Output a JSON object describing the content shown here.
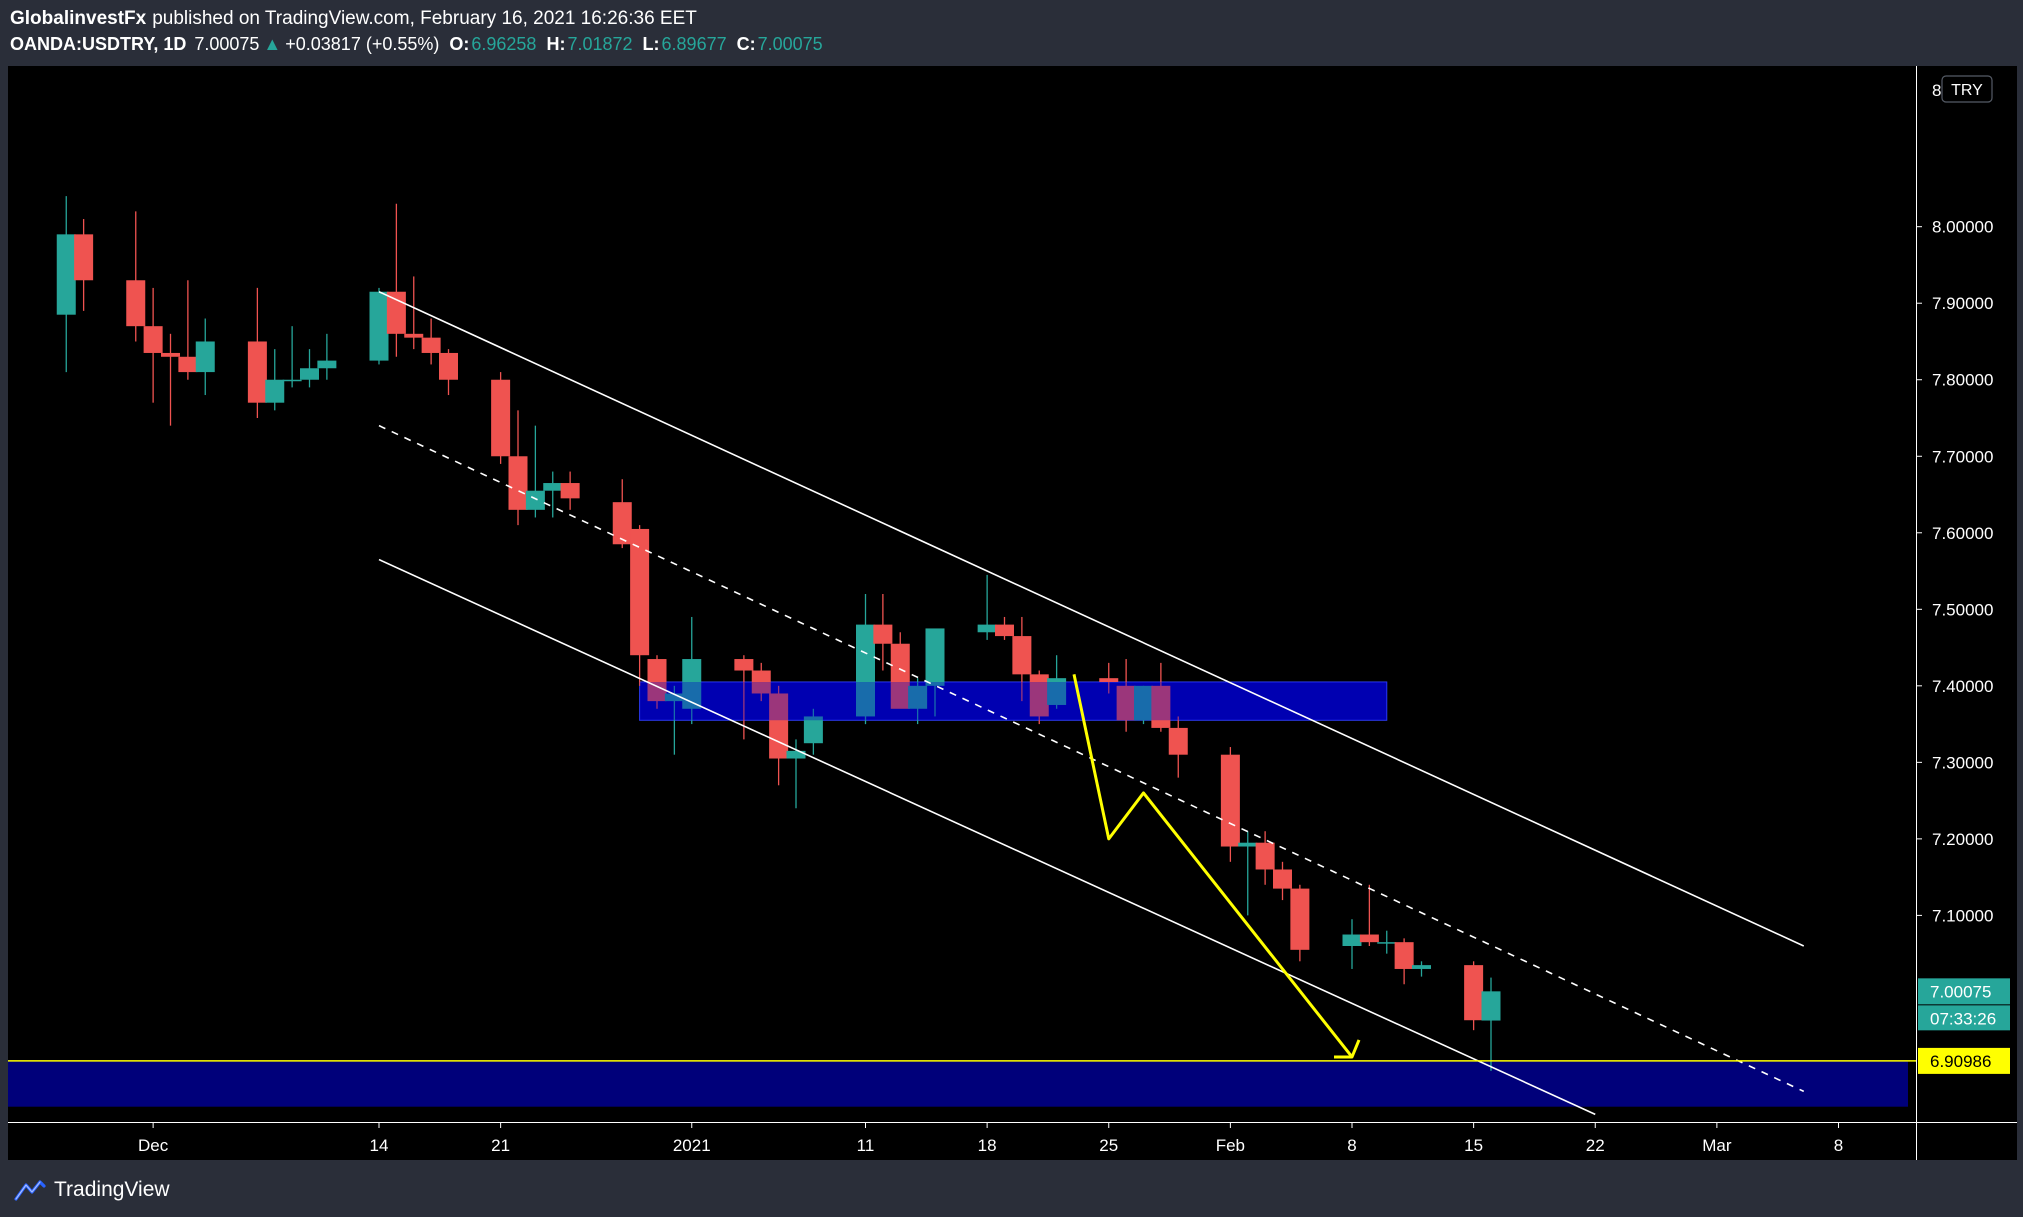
{
  "header": {
    "author": "GlobalinvestFx",
    "published": "published on TradingView.com, February 16, 2021 16:26:36 EET",
    "symbol": "OANDA:USDTRY, 1D",
    "last": "7.00075",
    "change": "+0.03817 (+0.55%)",
    "o_label": "O:",
    "o_value": "6.96258",
    "h_label": "H:",
    "h_value": "7.01872",
    "l_label": "L:",
    "l_value": "6.89677",
    "c_label": "C:",
    "c_value": "7.00075"
  },
  "footer": {
    "brand": "TradingView",
    "logo_icon": "tradingview-logo-icon"
  },
  "colors": {
    "up": "#26a69a",
    "down": "#ef5350",
    "zone": "#0000cc",
    "support": "#ffff00",
    "channel": "#ffffff",
    "path": "#ffff00",
    "background": "#000000",
    "axis_text": "#ffffff"
  },
  "chart_data": {
    "type": "candlestick",
    "currency": "TRY",
    "ylim": [
      6.83,
      8.21
    ],
    "y_ticks": [
      "8.00000",
      "7.90000",
      "7.80000",
      "7.70000",
      "7.60000",
      "7.50000",
      "7.40000",
      "7.30000",
      "7.20000",
      "7.10000"
    ],
    "x_ticks": [
      {
        "label": "Dec",
        "date": "2020-12-01"
      },
      {
        "label": "14",
        "date": "2020-12-14"
      },
      {
        "label": "21",
        "date": "2020-12-21"
      },
      {
        "label": "2021",
        "date": "2021-01-01"
      },
      {
        "label": "11",
        "date": "2021-01-11"
      },
      {
        "label": "18",
        "date": "2021-01-18"
      },
      {
        "label": "25",
        "date": "2021-01-25"
      },
      {
        "label": "Feb",
        "date": "2021-02-01"
      },
      {
        "label": "8",
        "date": "2021-02-08"
      },
      {
        "label": "15",
        "date": "2021-02-15"
      },
      {
        "label": "22",
        "date": "2021-02-22"
      },
      {
        "label": "Mar",
        "date": "2021-03-01"
      },
      {
        "label": "8",
        "date": "2021-03-08"
      }
    ],
    "price_labels": {
      "last_price": "7.00075",
      "countdown": "07:33:26",
      "support_price": "6.90986"
    },
    "candles": [
      {
        "date": "2020-11-26",
        "o": 7.885,
        "h": 8.04,
        "l": 7.81,
        "c": 7.99
      },
      {
        "date": "2020-11-27",
        "o": 7.99,
        "h": 8.01,
        "l": 7.89,
        "c": 7.93
      },
      {
        "date": "2020-11-30",
        "o": 7.93,
        "h": 8.02,
        "l": 7.85,
        "c": 7.87
      },
      {
        "date": "2020-12-01",
        "o": 7.87,
        "h": 7.92,
        "l": 7.77,
        "c": 7.835
      },
      {
        "date": "2020-12-02",
        "o": 7.835,
        "h": 7.86,
        "l": 7.74,
        "c": 7.83
      },
      {
        "date": "2020-12-03",
        "o": 7.83,
        "h": 7.93,
        "l": 7.8,
        "c": 7.81
      },
      {
        "date": "2020-12-04",
        "o": 7.81,
        "h": 7.88,
        "l": 7.78,
        "c": 7.85
      },
      {
        "date": "2020-12-07",
        "o": 7.85,
        "h": 7.92,
        "l": 7.75,
        "c": 7.77
      },
      {
        "date": "2020-12-08",
        "o": 7.77,
        "h": 7.84,
        "l": 7.76,
        "c": 7.8
      },
      {
        "date": "2020-12-09",
        "o": 7.8,
        "h": 7.87,
        "l": 7.79,
        "c": 7.8
      },
      {
        "date": "2020-12-10",
        "o": 7.8,
        "h": 7.84,
        "l": 7.79,
        "c": 7.815
      },
      {
        "date": "2020-12-11",
        "o": 7.815,
        "h": 7.86,
        "l": 7.8,
        "c": 7.825
      },
      {
        "date": "2020-12-14",
        "o": 7.825,
        "h": 7.92,
        "l": 7.82,
        "c": 7.915
      },
      {
        "date": "2020-12-15",
        "o": 7.915,
        "h": 8.03,
        "l": 7.83,
        "c": 7.86
      },
      {
        "date": "2020-12-16",
        "o": 7.86,
        "h": 7.935,
        "l": 7.84,
        "c": 7.855
      },
      {
        "date": "2020-12-17",
        "o": 7.855,
        "h": 7.88,
        "l": 7.82,
        "c": 7.835
      },
      {
        "date": "2020-12-18",
        "o": 7.835,
        "h": 7.84,
        "l": 7.78,
        "c": 7.8
      },
      {
        "date": "2020-12-21",
        "o": 7.8,
        "h": 7.81,
        "l": 7.69,
        "c": 7.7
      },
      {
        "date": "2020-12-22",
        "o": 7.7,
        "h": 7.76,
        "l": 7.61,
        "c": 7.63
      },
      {
        "date": "2020-12-23",
        "o": 7.63,
        "h": 7.74,
        "l": 7.62,
        "c": 7.655
      },
      {
        "date": "2020-12-24",
        "o": 7.655,
        "h": 7.68,
        "l": 7.62,
        "c": 7.665
      },
      {
        "date": "2020-12-25",
        "o": 7.665,
        "h": 7.68,
        "l": 7.63,
        "c": 7.645
      },
      {
        "date": "2020-12-28",
        "o": 7.64,
        "h": 7.67,
        "l": 7.58,
        "c": 7.585
      },
      {
        "date": "2020-12-29",
        "o": 7.605,
        "h": 7.61,
        "l": 7.4,
        "c": 7.44
      },
      {
        "date": "2020-12-30",
        "o": 7.435,
        "h": 7.44,
        "l": 7.37,
        "c": 7.38
      },
      {
        "date": "2020-12-31",
        "o": 7.38,
        "h": 7.4,
        "l": 7.31,
        "c": 7.39
      },
      {
        "date": "2021-01-01",
        "o": 7.37,
        "h": 7.49,
        "l": 7.35,
        "c": 7.435
      },
      {
        "date": "2021-01-04",
        "o": 7.435,
        "h": 7.44,
        "l": 7.33,
        "c": 7.42
      },
      {
        "date": "2021-01-05",
        "o": 7.42,
        "h": 7.43,
        "l": 7.38,
        "c": 7.39
      },
      {
        "date": "2021-01-06",
        "o": 7.39,
        "h": 7.4,
        "l": 7.27,
        "c": 7.305
      },
      {
        "date": "2021-01-07",
        "o": 7.305,
        "h": 7.33,
        "l": 7.24,
        "c": 7.315
      },
      {
        "date": "2021-01-08",
        "o": 7.325,
        "h": 7.37,
        "l": 7.31,
        "c": 7.36
      },
      {
        "date": "2021-01-11",
        "o": 7.36,
        "h": 7.52,
        "l": 7.35,
        "c": 7.48
      },
      {
        "date": "2021-01-12",
        "o": 7.48,
        "h": 7.52,
        "l": 7.42,
        "c": 7.455
      },
      {
        "date": "2021-01-13",
        "o": 7.455,
        "h": 7.47,
        "l": 7.38,
        "c": 7.37
      },
      {
        "date": "2021-01-14",
        "o": 7.37,
        "h": 7.41,
        "l": 7.35,
        "c": 7.4
      },
      {
        "date": "2021-01-15",
        "o": 7.4,
        "h": 7.47,
        "l": 7.36,
        "c": 7.475
      },
      {
        "date": "2021-01-18",
        "o": 7.47,
        "h": 7.545,
        "l": 7.46,
        "c": 7.48
      },
      {
        "date": "2021-01-19",
        "o": 7.48,
        "h": 7.49,
        "l": 7.46,
        "c": 7.465
      },
      {
        "date": "2021-01-20",
        "o": 7.465,
        "h": 7.49,
        "l": 7.38,
        "c": 7.415
      },
      {
        "date": "2021-01-21",
        "o": 7.415,
        "h": 7.42,
        "l": 7.35,
        "c": 7.36
      },
      {
        "date": "2021-01-22",
        "o": 7.375,
        "h": 7.44,
        "l": 7.37,
        "c": 7.41
      },
      {
        "date": "2021-01-25",
        "o": 7.41,
        "h": 7.43,
        "l": 7.39,
        "c": 7.405
      },
      {
        "date": "2021-01-26",
        "o": 7.4,
        "h": 7.435,
        "l": 7.34,
        "c": 7.355
      },
      {
        "date": "2021-01-27",
        "o": 7.355,
        "h": 7.4,
        "l": 7.35,
        "c": 7.4
      },
      {
        "date": "2021-01-28",
        "o": 7.4,
        "h": 7.43,
        "l": 7.34,
        "c": 7.345
      },
      {
        "date": "2021-01-29",
        "o": 7.345,
        "h": 7.36,
        "l": 7.28,
        "c": 7.31
      },
      {
        "date": "2021-02-01",
        "o": 7.31,
        "h": 7.32,
        "l": 7.17,
        "c": 7.19
      },
      {
        "date": "2021-02-02",
        "o": 7.19,
        "h": 7.21,
        "l": 7.1,
        "c": 7.195
      },
      {
        "date": "2021-02-03",
        "o": 7.195,
        "h": 7.21,
        "l": 7.14,
        "c": 7.16
      },
      {
        "date": "2021-02-04",
        "o": 7.16,
        "h": 7.17,
        "l": 7.12,
        "c": 7.135
      },
      {
        "date": "2021-02-05",
        "o": 7.135,
        "h": 7.14,
        "l": 7.04,
        "c": 7.055
      },
      {
        "date": "2021-02-08",
        "o": 7.06,
        "h": 7.095,
        "l": 7.03,
        "c": 7.075
      },
      {
        "date": "2021-02-09",
        "o": 7.075,
        "h": 7.14,
        "l": 7.06,
        "c": 7.065
      },
      {
        "date": "2021-02-10",
        "o": 7.065,
        "h": 7.08,
        "l": 7.05,
        "c": 7.065
      },
      {
        "date": "2021-02-11",
        "o": 7.065,
        "h": 7.07,
        "l": 7.01,
        "c": 7.03
      },
      {
        "date": "2021-02-12",
        "o": 7.03,
        "h": 7.04,
        "l": 7.02,
        "c": 7.035
      },
      {
        "date": "2021-02-15",
        "o": 7.035,
        "h": 7.04,
        "l": 6.95,
        "c": 6.963
      },
      {
        "date": "2021-02-16",
        "o": 6.96258,
        "h": 7.01872,
        "l": 6.89677,
        "c": 7.00075
      }
    ],
    "overlays": {
      "zones": [
        {
          "from": "2020-12-29",
          "to": "2021-02-10",
          "low": 7.355,
          "high": 7.405
        },
        {
          "from": "2020-11-20",
          "to": "2021-03-12",
          "low": 6.85,
          "high": 6.909
        }
      ],
      "support_line": 6.90986,
      "channel_upper": [
        {
          "date": "2020-12-14",
          "price": 7.915
        },
        {
          "date": "2021-03-06",
          "price": 7.06
        }
      ],
      "channel_mid": [
        {
          "date": "2020-12-14",
          "price": 7.74
        },
        {
          "date": "2021-03-06",
          "price": 6.87
        }
      ],
      "channel_lower": [
        {
          "date": "2020-12-14",
          "price": 7.565
        },
        {
          "date": "2021-02-22",
          "price": 6.84
        }
      ],
      "projection_path": [
        {
          "date": "2021-01-23",
          "price": 7.415
        },
        {
          "date": "2021-01-25",
          "price": 7.2
        },
        {
          "date": "2021-01-27",
          "price": 7.26
        },
        {
          "date": "2021-02-08",
          "price": 6.915
        }
      ]
    }
  }
}
